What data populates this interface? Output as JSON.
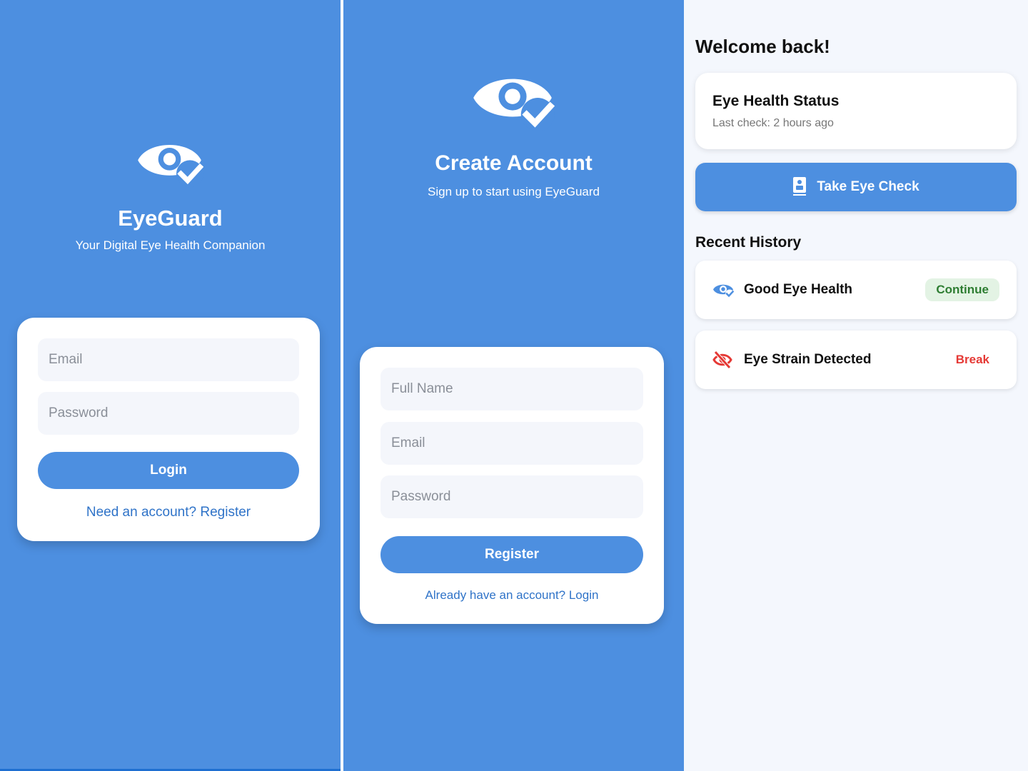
{
  "login": {
    "app_name": "EyeGuard",
    "tagline": "Your Digital Eye Health Companion",
    "email_placeholder": "Email",
    "password_placeholder": "Password",
    "login_button": "Login",
    "register_link": "Need an account? Register"
  },
  "register": {
    "title": "Create Account",
    "subtitle": "Sign up to start using EyeGuard",
    "full_name_placeholder": "Full Name",
    "email_placeholder": "Email",
    "password_placeholder": "Password",
    "register_button": "Register",
    "login_link": "Already have an account? Login"
  },
  "home": {
    "welcome": "Welcome back!",
    "status_card": {
      "title": "Eye Health Status",
      "last_check": "Last check: 2 hours ago"
    },
    "take_check_button": "Take Eye Check",
    "recent_history_title": "Recent History",
    "history": [
      {
        "label": "Good Eye Health",
        "action": "Continue",
        "icon": "eye-check-icon"
      },
      {
        "label": "Eye Strain Detected",
        "action": "Break",
        "icon": "eye-off-icon"
      }
    ]
  },
  "colors": {
    "primary": "#4d8fe0",
    "link": "#2f73c8",
    "success_bg": "#e3f3e4",
    "success_text": "#2e7d32",
    "danger": "#e53935"
  }
}
